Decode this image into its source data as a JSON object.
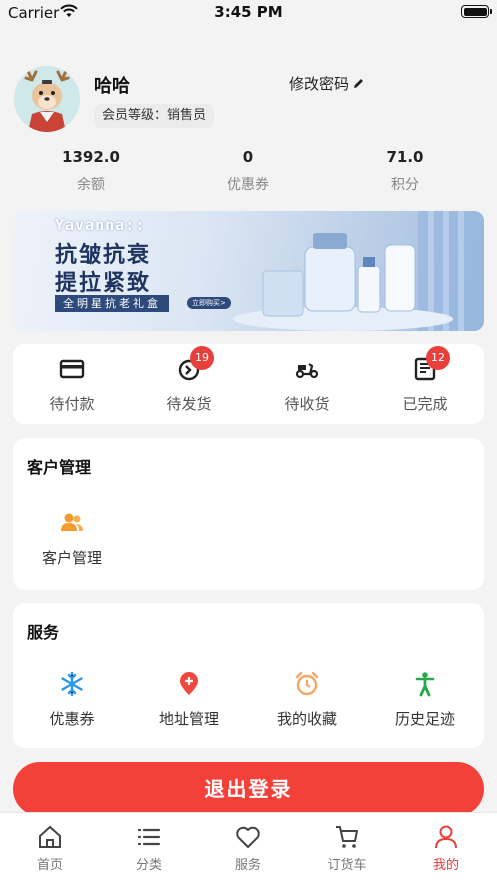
{
  "status_bar": {
    "carrier": "Carrier",
    "time": "3:45 PM"
  },
  "profile": {
    "name": "哈哈",
    "level": "会员等级：销售员",
    "change_password": "修改密码"
  },
  "stats": [
    {
      "value": "1392.0",
      "label": "余额"
    },
    {
      "value": "0",
      "label": "优惠券"
    },
    {
      "value": "71.0",
      "label": "积分"
    }
  ],
  "banner": {
    "brand": "Yavanna::",
    "headline_1": "抗皱抗衰",
    "headline_2": "提拉紧致",
    "subline": "全明星抗老礼盒",
    "buy_button": "立即购买>"
  },
  "orders": [
    {
      "label": "待付款",
      "icon": "wallet-icon",
      "badge": ""
    },
    {
      "label": "待发货",
      "icon": "pending-ship-icon",
      "badge": "19"
    },
    {
      "label": "待收货",
      "icon": "scooter-icon",
      "badge": ""
    },
    {
      "label": "已完成",
      "icon": "completed-list-icon",
      "badge": "12"
    }
  ],
  "customer_section": {
    "title": "客户管理",
    "items": [
      {
        "label": "客户管理",
        "icon": "users-icon"
      }
    ]
  },
  "service_section": {
    "title": "服务",
    "items": [
      {
        "label": "优惠券",
        "icon": "snowflake-icon"
      },
      {
        "label": "地址管理",
        "icon": "location-plus-icon"
      },
      {
        "label": "我的收藏",
        "icon": "alarm-clock-icon"
      },
      {
        "label": "历史足迹",
        "icon": "person-icon"
      }
    ]
  },
  "logout_label": "退出登录",
  "tabs": [
    {
      "label": "首页",
      "icon": "home-icon",
      "active": false
    },
    {
      "label": "分类",
      "icon": "list-icon",
      "active": false
    },
    {
      "label": "服务",
      "icon": "heart-icon",
      "active": false
    },
    {
      "label": "订货车",
      "icon": "cart-icon",
      "active": false
    },
    {
      "label": "我的",
      "icon": "user-icon",
      "active": true
    }
  ],
  "colors": {
    "accent": "#e8413b",
    "logout_button": "#f3413a",
    "coupon_icon": "#2a97e6",
    "location_icon": "#f0483e",
    "favorites_icon": "#f4a766",
    "history_icon": "#27a84a",
    "users_icon": "#f39a2b"
  }
}
